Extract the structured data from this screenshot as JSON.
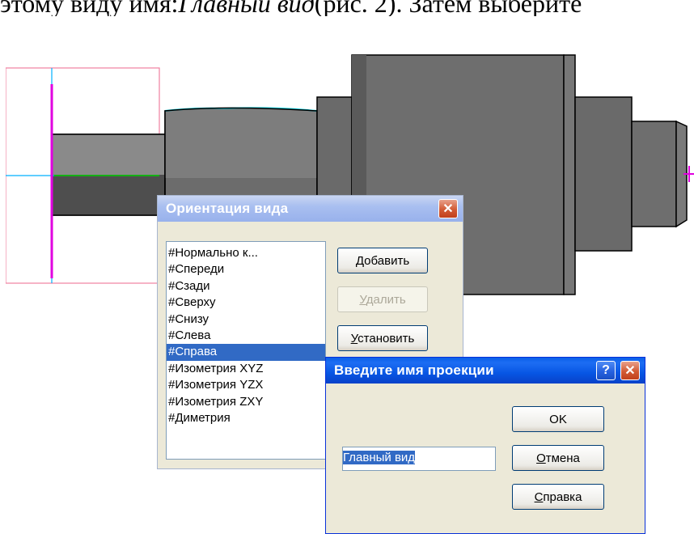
{
  "document_text": {
    "before_italic": "этому виду имя: ",
    "italic": "Главный вид",
    "after": " (рис. 2). Затем выберите"
  },
  "orientation_dialog": {
    "title": "Ориентация вида",
    "list_items": [
      "#Нормально к...",
      "#Спереди",
      "#Сзади",
      "#Сверху",
      "#Снизу",
      "#Слева",
      "#Справа",
      "#Изометрия XYZ",
      "#Изометрия YZX",
      "#Изометрия ZXY",
      "#Диметрия"
    ],
    "selected_item": "#Справа",
    "add_button": {
      "prefix": "",
      "hotkey": "Д",
      "rest": "обавить"
    },
    "delete_button": {
      "prefix": "",
      "hotkey": "У",
      "rest": "далить",
      "disabled": true
    },
    "set_button": {
      "prefix": "",
      "hotkey": "У",
      "rest": "становить"
    }
  },
  "projection_dialog": {
    "title": "Введите имя проекции",
    "input_value": "Главный вид",
    "ok_button": "OK",
    "cancel_button": {
      "hotkey": "О",
      "rest": "тмена"
    },
    "help_button": {
      "prefix": "",
      "hotkey": "С",
      "rest": "правка"
    }
  },
  "colors": {
    "title_active": "#0a5fe8",
    "title_inactive": "#a9bff0",
    "selection": "#316ac5",
    "dialog_bg": "#ece9d8",
    "model_gray": "#6e6e6e",
    "axis_magenta": "#e000e0",
    "axis_cyan": "#00c8ff"
  }
}
